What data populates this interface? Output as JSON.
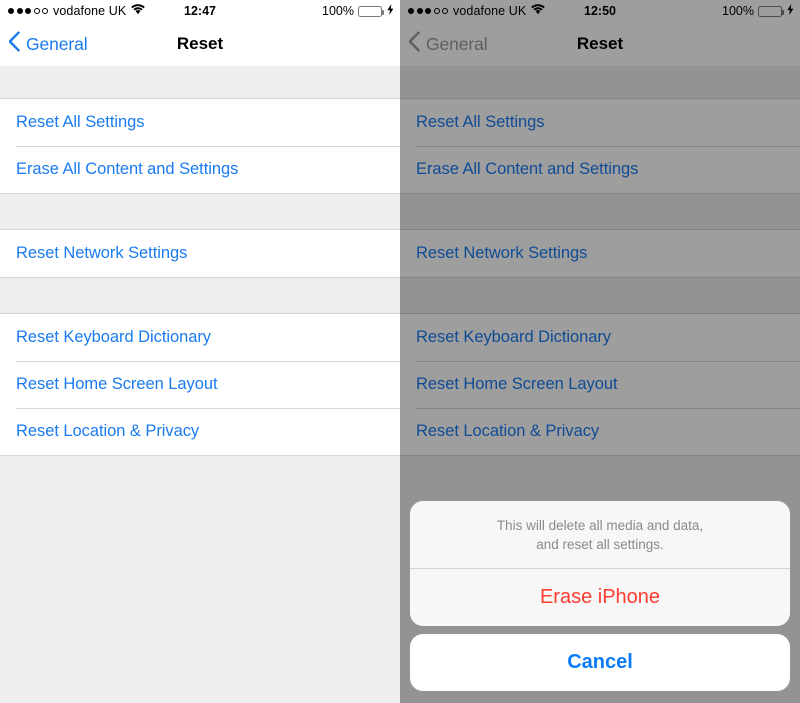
{
  "panels": [
    {
      "id": "left",
      "dimmed": false,
      "status_bar": {
        "signal_dots_filled": 3,
        "signal_dots_total": 5,
        "carrier": "vodafone UK",
        "wifi_icon": "wifi-icon",
        "time": "12:47",
        "battery_percent": "100%",
        "battery_fill": 100,
        "charging_icon": "lightning-bolt-icon",
        "battery_color": "#4cd964"
      },
      "nav": {
        "back_icon": "chevron-left-icon",
        "back_label": "General",
        "title": "Reset"
      }
    },
    {
      "id": "right",
      "dimmed": true,
      "status_bar": {
        "signal_dots_filled": 3,
        "signal_dots_total": 5,
        "carrier": "vodafone UK",
        "wifi_icon": "wifi-icon",
        "time": "12:50",
        "battery_percent": "100%",
        "battery_fill": 100,
        "charging_icon": "lightning-bolt-icon",
        "battery_color": "#4cd964"
      },
      "nav": {
        "back_icon": "chevron-left-icon",
        "back_label": "General",
        "title": "Reset"
      }
    }
  ],
  "list": {
    "groups": [
      {
        "items": [
          {
            "label": "Reset All Settings"
          },
          {
            "label": "Erase All Content and Settings"
          }
        ]
      },
      {
        "items": [
          {
            "label": "Reset Network Settings"
          }
        ]
      },
      {
        "items": [
          {
            "label": "Reset Keyboard Dictionary"
          },
          {
            "label": "Reset Home Screen Layout"
          },
          {
            "label": "Reset Location & Privacy"
          }
        ]
      }
    ]
  },
  "action_sheet": {
    "message_line_1": "This will delete all media and data,",
    "message_line_2": "and reset all settings.",
    "destructive_label": "Erase iPhone",
    "cancel_label": "Cancel",
    "destructive_color": "#ff3b30",
    "cancel_color": "#0a7cf7"
  },
  "colors": {
    "tint_blue": "#1a7bf0",
    "group_background": "#eeeef0",
    "separator": "#d6d6da",
    "row_background": "#ffffff"
  }
}
